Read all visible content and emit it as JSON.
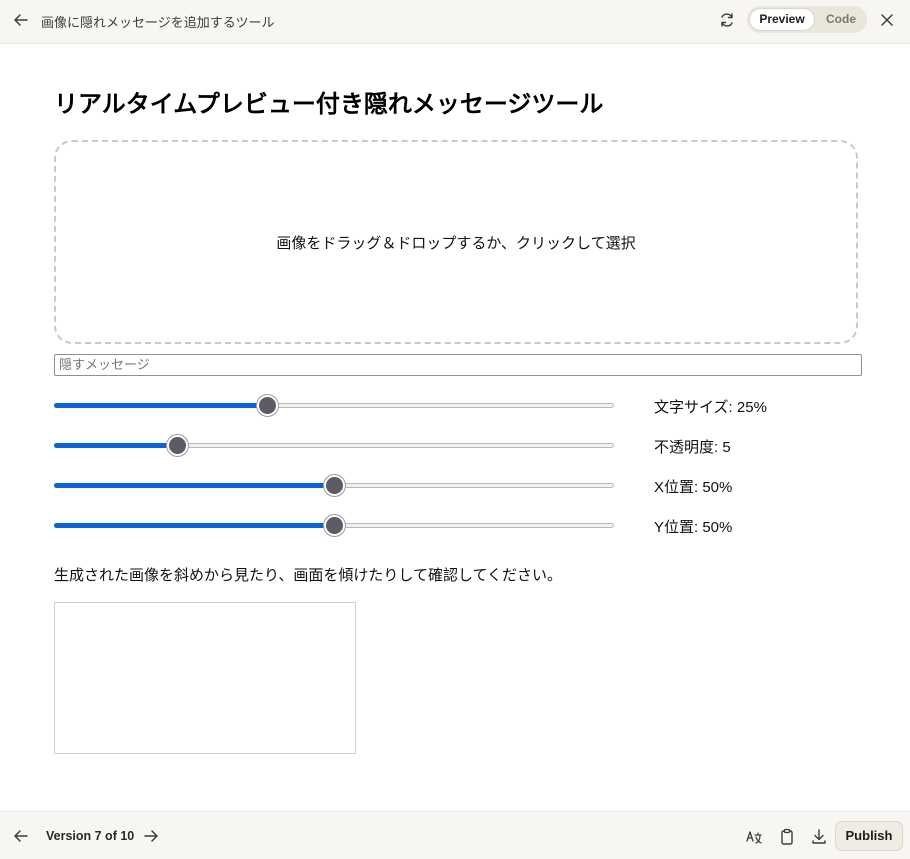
{
  "header": {
    "title": "画像に隠れメッセージを追加するツール",
    "back_icon": "arrow-left-icon",
    "refresh_icon": "refresh-icon",
    "close_icon": "close-icon",
    "tabs": [
      {
        "label": "Preview",
        "active": true
      },
      {
        "label": "Code",
        "active": false
      }
    ]
  },
  "main": {
    "heading": "リアルタイムプレビュー付き隠れメッセージツール",
    "dropzone_text": "画像をドラッグ＆ドロップするか、クリックして選択",
    "message_input": {
      "value": "",
      "placeholder": "隠すメッセージ"
    },
    "sliders": [
      {
        "label": "文字サイズ: 25%",
        "fraction": 0.38
      },
      {
        "label": "不透明度: 5",
        "fraction": 0.22
      },
      {
        "label": "X位置: 50%",
        "fraction": 0.5
      },
      {
        "label": "Y位置: 50%",
        "fraction": 0.5
      }
    ],
    "hint": "生成された画像を斜めから見たり、画面を傾けたりして確認してください。"
  },
  "footer": {
    "version": "Version 7 of 10",
    "publish_label": "Publish",
    "icons": [
      "arrow-left-icon",
      "arrow-right-icon",
      "translate-icon",
      "clipboard-icon",
      "download-icon"
    ]
  },
  "colors": {
    "accent": "#0b63d6",
    "thumb": "#5c5b66",
    "chrome_bg": "#f7f6f2"
  }
}
